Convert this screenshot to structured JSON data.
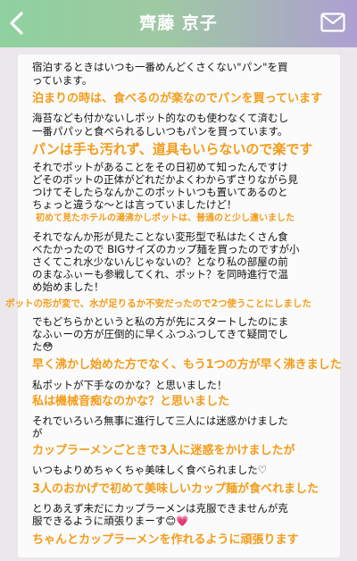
{
  "header": {
    "title": "齊藤 京子",
    "back_icon": "chevron-left-icon",
    "mail_icon": "mail-icon"
  },
  "message": {
    "lines": [
      "宿泊するときはいつも一番めんどくさくない\"パン\"を買",
      "っています。",
      "泊まりの時は、食べるのが楽なのでパンを買っています",
      "海苔なども付かないしポット的なのも使わなくて済むし",
      "一番パパッと食べられるしいつもパンを買っています。",
      "パンは手も汚れず、道具もいらないので楽です",
      "それでポットがあることをその日初めて知ったんですけ",
      "どそのポットの正体がどれだかよくわからずさりながら見",
      "つけてそしたらなんかこのポットいつも置いてあるのと",
      "ちょっと違うな～とは言っていましたけど！",
      "初めて見たホテルの湯沸かしポットは、普通のと少し違いました",
      "それでなんか形が見たことない変形型で私はたくさん食",
      "べたかったので BIGサイズのカップ麺を買ったのですが小",
      "さくてこれ水少ないんじゃないの？となり私の部屋の前",
      "のまなふぃーも参戦してくれ、ポット？を同時進行で温",
      "め始めました！",
      "ポットの形が変で、水が足りるか不安だったので2つ使うことにしました",
      "でもどちらかというと私の方が先にスタートしたのにま",
      "なふぃーの方が圧倒的に早くふつふつしてきて疑問でし",
      "た😳",
      "早く沸かし始めた方でなく、もう1つの方が早く沸きました",
      "私ポットが下手なのかな？と思いました！",
      "私は機械音痴なのかな？と思いました",
      "それでいろいろ無事に進行して三人には迷惑かけました",
      "が",
      "カップラーメンごときで3人に迷惑をかけましたが",
      "いつもよりめちゃくちゃ美味しく食べられました♡",
      "3人のおかげで初めて美味しいカップ麺が食べれました",
      "とりあえず未だにカップラーメンは克服できませんが克",
      "服できるように頑張りまーす😊💗",
      "ちゃんとカップラーメンを作れるように頑張ります"
    ]
  },
  "colors": {
    "accent_orange": "#f39c1a",
    "header_left": "#8fd19f",
    "header_right": "#ae9fd2"
  }
}
